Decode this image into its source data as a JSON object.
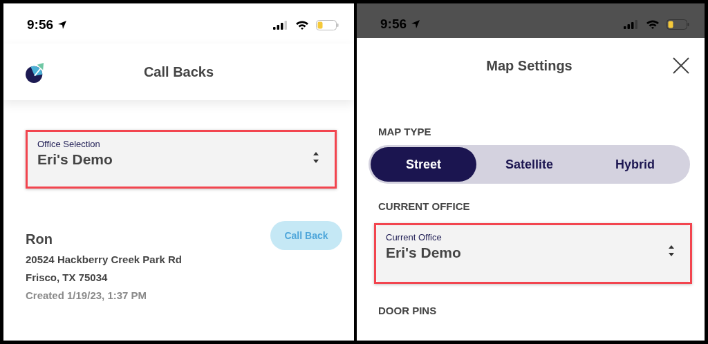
{
  "left_screen": {
    "status_bar": {
      "time": "9:56"
    },
    "header": {
      "title": "Call Backs"
    },
    "office_selection": {
      "label": "Office Selection",
      "value": "Eri's Demo",
      "highlighted": true
    },
    "call_backs": [
      {
        "name": "Ron",
        "address_line_1": "20524 Hackberry Creek Park Rd",
        "address_line_2": "Frisco, TX 75034",
        "created": "Created 1/19/23, 1:37 PM",
        "action": "Call Back"
      }
    ]
  },
  "right_screen": {
    "status_bar": {
      "time": "9:56"
    },
    "sheet": {
      "title": "Map Settings",
      "sections": [
        {
          "heading": "MAP TYPE",
          "kind": "segmented",
          "options": [
            {
              "label": "Street",
              "selected": true
            },
            {
              "label": "Satellite",
              "selected": false
            },
            {
              "label": "Hybrid",
              "selected": false
            }
          ]
        },
        {
          "heading": "CURRENT OFFICE",
          "kind": "select",
          "field": {
            "label": "Current Office",
            "value": "Eri's Demo",
            "highlighted": true
          }
        },
        {
          "heading": "DOOR PINS",
          "kind": "heading"
        }
      ]
    }
  }
}
